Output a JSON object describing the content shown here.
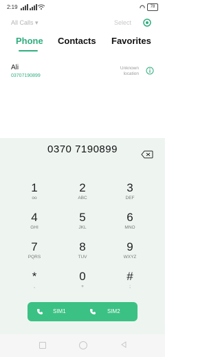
{
  "status": {
    "time": "2:19",
    "battery": "78"
  },
  "header": {
    "filter_label": "All Calls ▾",
    "select_label": "Select"
  },
  "tabs": [
    {
      "label": "Phone"
    },
    {
      "label": "Contacts"
    },
    {
      "label": "Favorites"
    }
  ],
  "recent_call": {
    "name": "Ali",
    "number": "03707190899",
    "location": "Unknown\nlocation"
  },
  "dialer": {
    "input": "0370 7190899",
    "keys": [
      {
        "digit": "1",
        "letters": "ᴏᴏ"
      },
      {
        "digit": "2",
        "letters": "ABC"
      },
      {
        "digit": "3",
        "letters": "DEF"
      },
      {
        "digit": "4",
        "letters": "GHI"
      },
      {
        "digit": "5",
        "letters": "JKL"
      },
      {
        "digit": "6",
        "letters": "MNO"
      },
      {
        "digit": "7",
        "letters": "PQRS"
      },
      {
        "digit": "8",
        "letters": "TUV"
      },
      {
        "digit": "9",
        "letters": "WXYZ"
      },
      {
        "digit": "*",
        "letters": ","
      },
      {
        "digit": "0",
        "letters": "+"
      },
      {
        "digit": "#",
        "letters": ";"
      }
    ],
    "sim1": "SIM1",
    "sim2": "SIM2"
  },
  "colors": {
    "accent": "#2fae7e",
    "call_button": "#3bc183",
    "pad_bg": "#eef5f1"
  }
}
